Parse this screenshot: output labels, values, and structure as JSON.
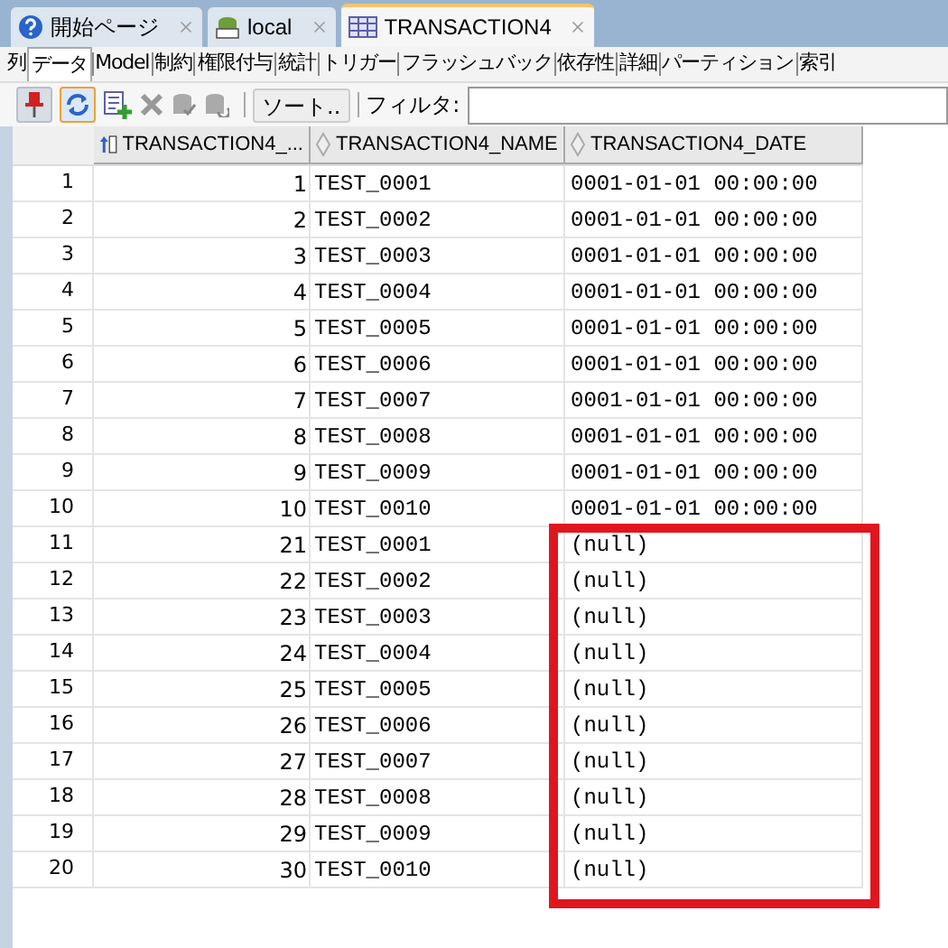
{
  "editor_tabs": [
    {
      "label": "開始ページ",
      "kind": "help",
      "selected": false
    },
    {
      "label": "local",
      "kind": "sql",
      "selected": false
    },
    {
      "label": "TRANSACTION4",
      "kind": "table",
      "selected": true
    }
  ],
  "sub_tabs": [
    {
      "label": "列",
      "selected": false
    },
    {
      "label": "データ",
      "selected": true
    },
    {
      "label": "Model",
      "selected": false
    },
    {
      "label": "制約",
      "selected": false
    },
    {
      "label": "権限付与",
      "selected": false
    },
    {
      "label": "統計",
      "selected": false
    },
    {
      "label": "トリガー",
      "selected": false
    },
    {
      "label": "フラッシュバック",
      "selected": false
    },
    {
      "label": "依存性",
      "selected": false
    },
    {
      "label": "詳細",
      "selected": false
    },
    {
      "label": "パーティション",
      "selected": false
    },
    {
      "label": "索引",
      "selected": false
    }
  ],
  "toolbar": {
    "sort_button": "ソート..",
    "filter_label": "フィルタ:"
  },
  "table": {
    "columns": [
      {
        "label": "TRANSACTION4_...",
        "kind": "sorted"
      },
      {
        "label": "TRANSACTION4_NAME",
        "kind": "plain"
      },
      {
        "label": "TRANSACTION4_DATE",
        "kind": "plain"
      }
    ],
    "rows": [
      {
        "number": "1",
        "cells": [
          "1",
          "TEST_0001",
          "0001-01-01 00:00:00"
        ]
      },
      {
        "number": "2",
        "cells": [
          "2",
          "TEST_0002",
          "0001-01-01 00:00:00"
        ]
      },
      {
        "number": "3",
        "cells": [
          "3",
          "TEST_0003",
          "0001-01-01 00:00:00"
        ]
      },
      {
        "number": "4",
        "cells": [
          "4",
          "TEST_0004",
          "0001-01-01 00:00:00"
        ]
      },
      {
        "number": "5",
        "cells": [
          "5",
          "TEST_0005",
          "0001-01-01 00:00:00"
        ]
      },
      {
        "number": "6",
        "cells": [
          "6",
          "TEST_0006",
          "0001-01-01 00:00:00"
        ]
      },
      {
        "number": "7",
        "cells": [
          "7",
          "TEST_0007",
          "0001-01-01 00:00:00"
        ]
      },
      {
        "number": "8",
        "cells": [
          "8",
          "TEST_0008",
          "0001-01-01 00:00:00"
        ]
      },
      {
        "number": "9",
        "cells": [
          "9",
          "TEST_0009",
          "0001-01-01 00:00:00"
        ]
      },
      {
        "number": "10",
        "cells": [
          "10",
          "TEST_0010",
          "0001-01-01 00:00:00"
        ]
      },
      {
        "number": "11",
        "cells": [
          "21",
          "TEST_0001",
          "(null)"
        ]
      },
      {
        "number": "12",
        "cells": [
          "22",
          "TEST_0002",
          "(null)"
        ]
      },
      {
        "number": "13",
        "cells": [
          "23",
          "TEST_0003",
          "(null)"
        ]
      },
      {
        "number": "14",
        "cells": [
          "24",
          "TEST_0004",
          "(null)"
        ]
      },
      {
        "number": "15",
        "cells": [
          "25",
          "TEST_0005",
          "(null)"
        ]
      },
      {
        "number": "16",
        "cells": [
          "26",
          "TEST_0006",
          "(null)"
        ]
      },
      {
        "number": "17",
        "cells": [
          "27",
          "TEST_0007",
          "(null)"
        ]
      },
      {
        "number": "18",
        "cells": [
          "28",
          "TEST_0008",
          "(null)"
        ]
      },
      {
        "number": "19",
        "cells": [
          "29",
          "TEST_0009",
          "(null)"
        ]
      },
      {
        "number": "20",
        "cells": [
          "30",
          "TEST_0010",
          "(null)"
        ]
      }
    ]
  }
}
